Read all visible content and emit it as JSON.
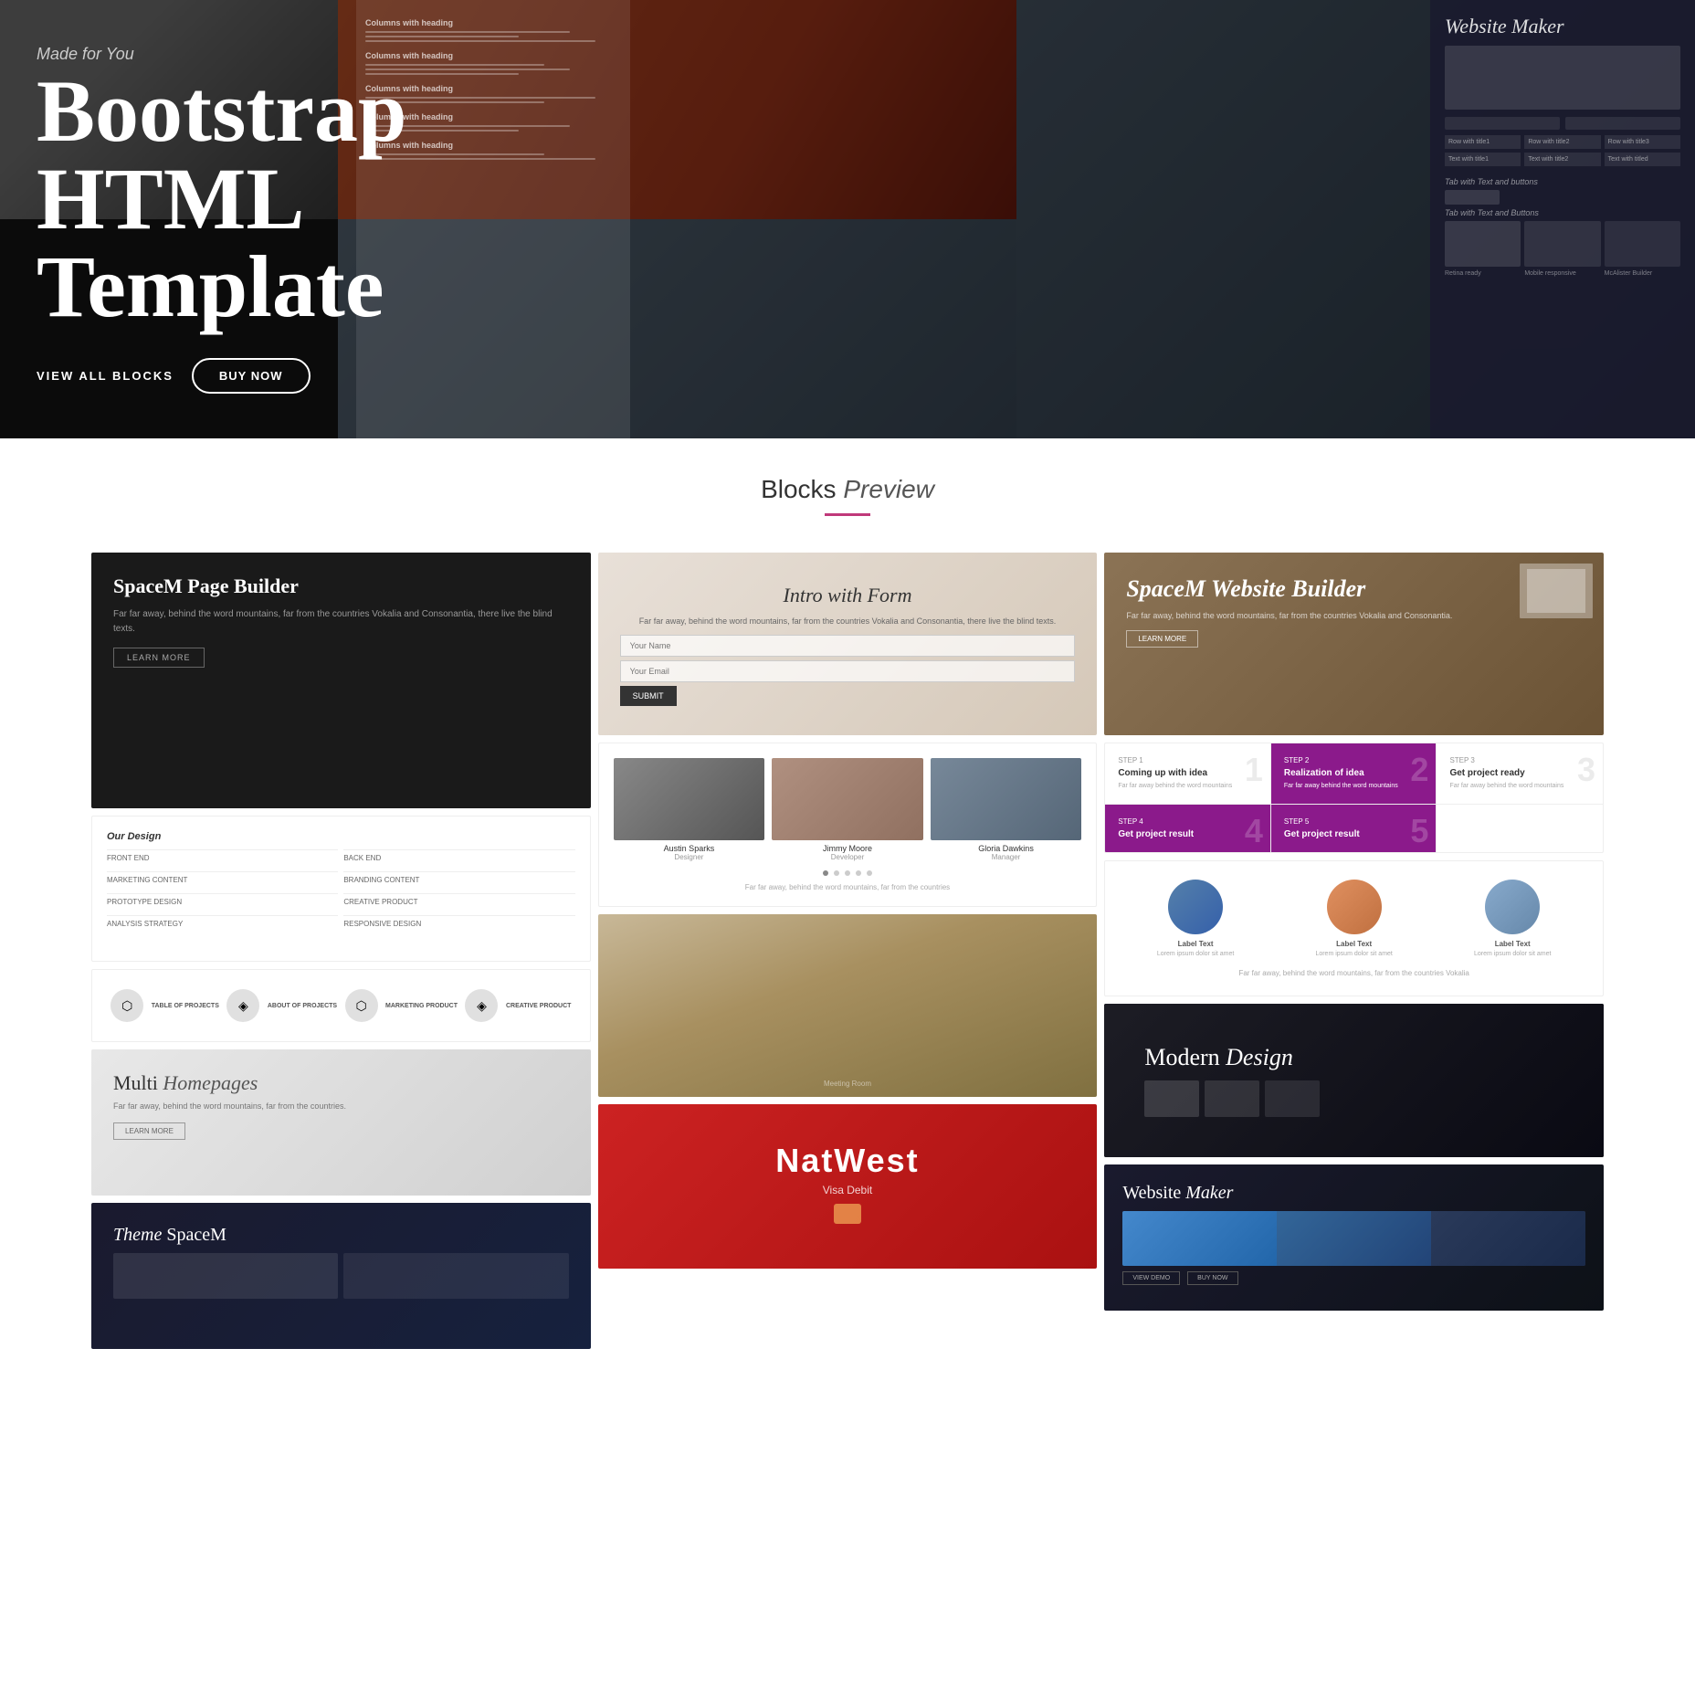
{
  "hero": {
    "subtitle": "Made for You",
    "title": "Bootstrap\nHTML\nTemplate",
    "btn_view": "VIEW ALL BLOCKS",
    "btn_buy": "BUY NOW"
  },
  "section": {
    "title": "Blocks",
    "title_italic": "Preview",
    "underline_color": "#c0397a"
  },
  "cards": {
    "spacem_page": {
      "title": "SpaceM Page Builder",
      "text": "Far far away, behind the word mountains, far from the countries Vokalia and Consonantia, there live the blind texts.",
      "btn": "LEARN MORE"
    },
    "our_design": {
      "title": "Our Design",
      "items": [
        "FRONT END",
        "BACK END",
        "MARKETING CONTENT",
        "BRANDING CONTENT",
        "PROTOTYPE DESIGN",
        "CREATIVE PRODUCT",
        "ANALYSIS STRATEGY",
        "RESPONSIVE DESIGN"
      ]
    },
    "intro_form": {
      "title": "Intro with",
      "title_italic": "Form",
      "text": "Far far away, behind the word mountains, far from the countries Vokalia and Consonantia, there live the blind texts."
    },
    "team": {
      "members": [
        {
          "name": "Austin Sparks",
          "role": "Designer"
        },
        {
          "name": "Jimmy Moore",
          "role": "Developer"
        },
        {
          "name": "Gloria Dawkins",
          "role": "Manager"
        }
      ]
    },
    "spacem_builder": {
      "title": "SpaceM\nWebsite\nBuilder"
    },
    "steps": {
      "items": [
        {
          "label": "STEP 1",
          "title": "Coming up with idea",
          "number": "1"
        },
        {
          "label": "STEP 2",
          "title": "Realization of idea",
          "number": "2"
        },
        {
          "label": "STEP 3",
          "title": "Get project ready",
          "number": "3"
        },
        {
          "label": "STEP 4",
          "title": "Get project result",
          "number": "4"
        },
        {
          "label": "STEP 5",
          "title": "Get project result",
          "number": "5"
        }
      ]
    },
    "icons": {
      "labels": [
        "TABLE OF PROJECTS",
        "ABOUT OF PROJECTS",
        "MARKETING PRODUCT",
        "CREATIVE PRODUCT"
      ]
    },
    "meeting_room": {},
    "circles": {
      "items": [
        {
          "label": "Label Text",
          "text": "Lorem ipsum dolor sit amet"
        },
        {
          "label": "Label Text",
          "text": "Lorem ipsum dolor sit amet"
        },
        {
          "label": "Label Text",
          "text": "Lorem ipsum dolor sit amet"
        }
      ]
    },
    "multi_hp": {
      "title": "Multi",
      "title_italic": "Homepages",
      "text": "Far far away, behind the word mountains, far from the countries.",
      "btn": "LEARN MORE"
    },
    "modern_design": {
      "title": "Modern",
      "title_italic": "Design"
    },
    "spacem_theme": {
      "title": "SpaceM",
      "title_italic": "Theme"
    },
    "natwest": {
      "brand": "NatWest",
      "subtitle": "Visa Debit"
    },
    "website_maker": {
      "title": "Website",
      "title_italic": "Maker"
    }
  },
  "hero_right_preview": {
    "title": "Website Maker"
  },
  "hero_right_rows": [
    {
      "label": "Row with title1"
    },
    {
      "label": "Row with title2"
    },
    {
      "label": "Row with title3"
    },
    {
      "label": "Text with title1"
    },
    {
      "label": "Text with title2"
    },
    {
      "label": "Text with titled"
    }
  ]
}
